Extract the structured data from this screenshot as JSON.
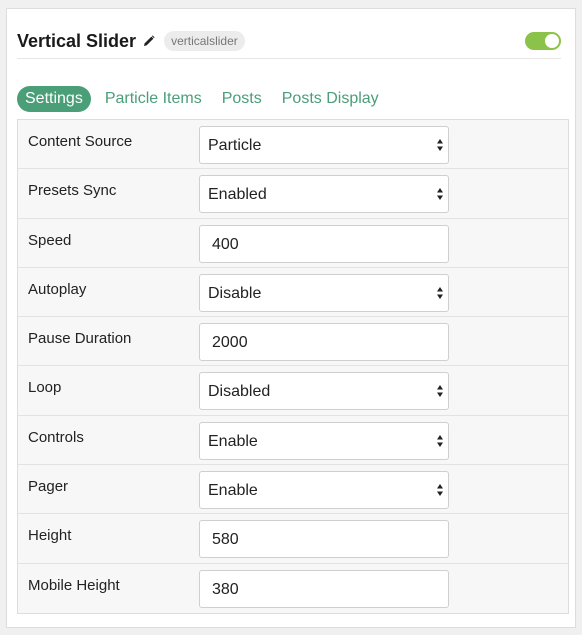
{
  "header": {
    "title": "Vertical Slider",
    "tag": "verticalslider",
    "enabled": true
  },
  "icons": {
    "edit": "pencil-icon",
    "toggle": "toggle-switch",
    "select": "up-down-arrows-icon"
  },
  "colors": {
    "accent": "#4a9e78",
    "toggle_on": "#8bc34a"
  },
  "tabs": [
    {
      "label": "Settings",
      "active": true
    },
    {
      "label": "Particle Items",
      "active": false
    },
    {
      "label": "Posts",
      "active": false
    },
    {
      "label": "Posts Display",
      "active": false
    }
  ],
  "fields": [
    {
      "label": "Content Source",
      "type": "select",
      "value": "Particle"
    },
    {
      "label": "Presets Sync",
      "type": "select",
      "value": "Enabled"
    },
    {
      "label": "Speed",
      "type": "input",
      "value": "400"
    },
    {
      "label": "Autoplay",
      "type": "select",
      "value": "Disable"
    },
    {
      "label": "Pause Duration",
      "type": "input",
      "value": "2000"
    },
    {
      "label": "Loop",
      "type": "select",
      "value": "Disabled"
    },
    {
      "label": "Controls",
      "type": "select",
      "value": "Enable"
    },
    {
      "label": "Pager",
      "type": "select",
      "value": "Enable"
    },
    {
      "label": "Height",
      "type": "input",
      "value": "580"
    },
    {
      "label": "Mobile Height",
      "type": "input",
      "value": "380"
    }
  ]
}
